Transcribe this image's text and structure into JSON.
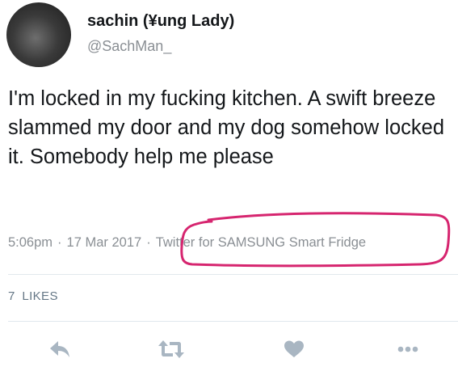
{
  "tweet": {
    "display_name": "sachin (¥ung Lady)",
    "handle": "@SachMan_",
    "text": "I'm locked in my fucking kitchen. A swift breeze slammed my door and my dog somehow locked it. Somebody help me please",
    "time": "5:06pm",
    "date": "17 Mar 2017",
    "separator": "·",
    "source": "Twitter for SAMSUNG Smart Fridge",
    "likes_count": "7",
    "likes_label": "LIKES"
  },
  "actions": [
    {
      "name": "reply-button",
      "icon": "reply-icon"
    },
    {
      "name": "retweet-button",
      "icon": "retweet-icon"
    },
    {
      "name": "like-button",
      "icon": "heart-icon"
    },
    {
      "name": "more-button",
      "icon": "more-icon"
    }
  ],
  "colors": {
    "text": "#14171a",
    "muted": "#8a8f94",
    "icon": "#a9b6c2",
    "annotation": "#d6256f",
    "divider": "#e1e8ed"
  }
}
